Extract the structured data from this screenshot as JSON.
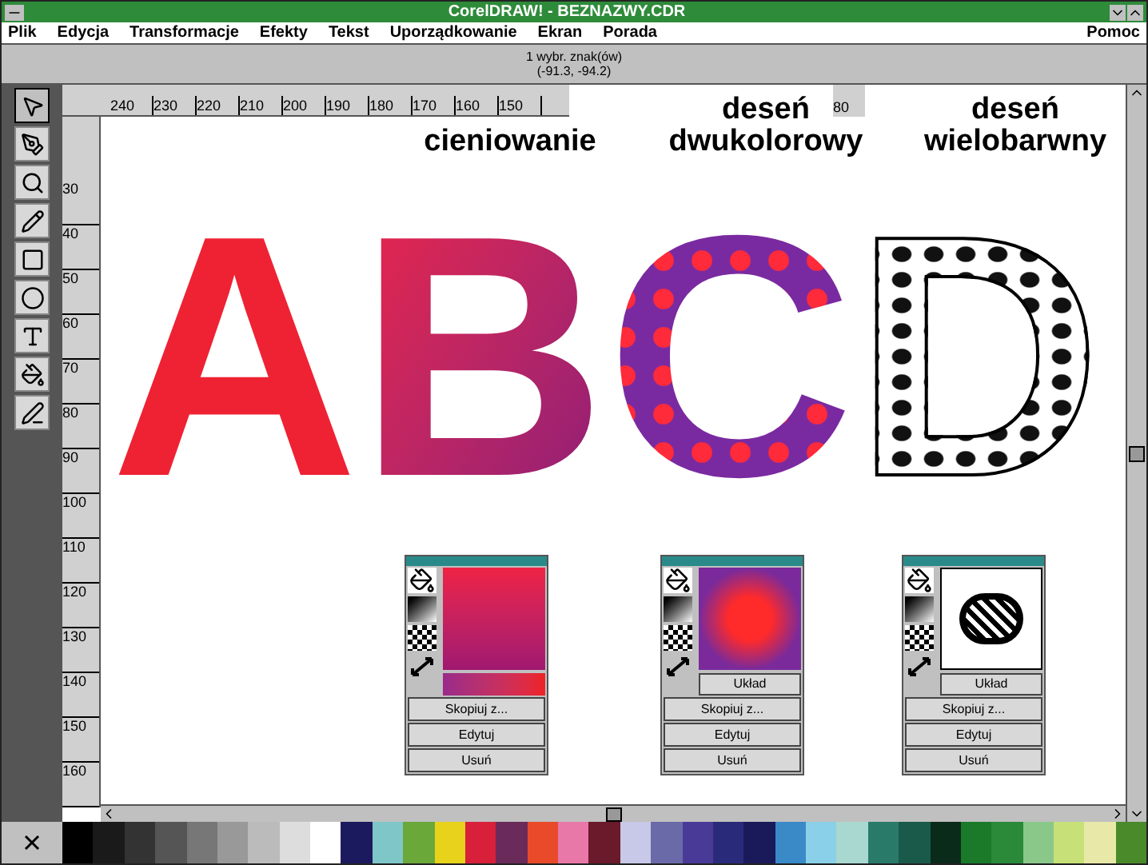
{
  "window": {
    "title": "CorelDRAW! - BEZNAZWY.CDR"
  },
  "menu": [
    {
      "label": "Plik"
    },
    {
      "label": "Edycja"
    },
    {
      "label": "Transformacje"
    },
    {
      "label": "Efekty"
    },
    {
      "label": "Tekst"
    },
    {
      "label": "Uporządkowanie"
    },
    {
      "label": "Ekran"
    },
    {
      "label": "Porada"
    }
  ],
  "help_menu": {
    "label": "Pomoc"
  },
  "status_bar": {
    "selection": "1 wybr. znak(ów)",
    "coordinates": "(-91.3, -94.2)"
  },
  "tools": [
    {
      "kind": "pick",
      "selected": true
    },
    {
      "kind": "shape",
      "selected": false
    },
    {
      "kind": "zoom",
      "selected": false
    },
    {
      "kind": "pencil",
      "selected": false
    },
    {
      "kind": "rectangle",
      "selected": false
    },
    {
      "kind": "ellipse",
      "selected": false
    },
    {
      "kind": "text",
      "selected": false
    },
    {
      "kind": "fill",
      "selected": false
    },
    {
      "kind": "outline",
      "selected": false
    }
  ],
  "horizontal_ruler": [
    "240",
    "230",
    "220",
    "210",
    "200",
    "190",
    "180",
    "170",
    "160",
    "150"
  ],
  "horizontal_ruler_extra": "80",
  "vertical_ruler": [
    "30",
    "40",
    "50",
    "60",
    "70",
    "80",
    "90",
    "100",
    "110",
    "120",
    "130",
    "140",
    "150",
    "160"
  ],
  "captions": [
    {
      "lines": [
        "cieniowanie"
      ]
    },
    {
      "lines": [
        "deseń",
        "dwukolorowy"
      ]
    },
    {
      "lines": [
        "deseń",
        "wielobarwny"
      ]
    }
  ],
  "letters": [
    {
      "text": "A",
      "kind": "solid"
    },
    {
      "text": "B",
      "kind": "gradient"
    },
    {
      "text": "C",
      "kind": "two_color"
    },
    {
      "text": "D",
      "kind": "full_color"
    }
  ],
  "fill_dialogs": [
    {
      "kind": "gradient",
      "buttons": [
        "Skopiuj z...",
        "Edytuj",
        "Usuń"
      ]
    },
    {
      "kind": "two_color",
      "layout_button": "Układ",
      "buttons": [
        "Skopiuj z...",
        "Edytuj",
        "Usuń"
      ]
    },
    {
      "kind": "full_color",
      "layout_button": "Układ",
      "buttons": [
        "Skopiuj z...",
        "Edytuj",
        "Usuń"
      ]
    }
  ],
  "palette": [
    {
      "color": "#000000"
    },
    {
      "color": "#1a1a1a"
    },
    {
      "color": "#333333"
    },
    {
      "color": "#555555"
    },
    {
      "color": "#777777"
    },
    {
      "color": "#999999"
    },
    {
      "color": "#bbbbbb"
    },
    {
      "color": "#dddddd"
    },
    {
      "color": "#ffffff"
    },
    {
      "color": "#1c1a5e"
    },
    {
      "color": "#7fc6c8"
    },
    {
      "color": "#6aa83a"
    },
    {
      "color": "#e8d21c"
    },
    {
      "color": "#d8203a"
    },
    {
      "color": "#6a2a5a"
    },
    {
      "color": "#e84a2a"
    },
    {
      "color": "#e878a8"
    },
    {
      "color": "#6a1a2a"
    },
    {
      "color": "#c8c8e8"
    },
    {
      "color": "#6a6aa8"
    },
    {
      "color": "#4a3a98"
    },
    {
      "color": "#2a2a7a"
    },
    {
      "color": "#1a1a5a"
    },
    {
      "color": "#3a8ac8"
    },
    {
      "color": "#8ad0e8"
    },
    {
      "color": "#a8d8d0"
    },
    {
      "color": "#2a7a6a"
    },
    {
      "color": "#1a5a4a"
    },
    {
      "color": "#0a2a1a"
    },
    {
      "color": "#1a7a2a"
    },
    {
      "color": "#2a8a3a"
    },
    {
      "color": "#8ac88a"
    },
    {
      "color": "#c8e078"
    },
    {
      "color": "#e8e8a8"
    },
    {
      "color": "#4a8a2a"
    }
  ]
}
